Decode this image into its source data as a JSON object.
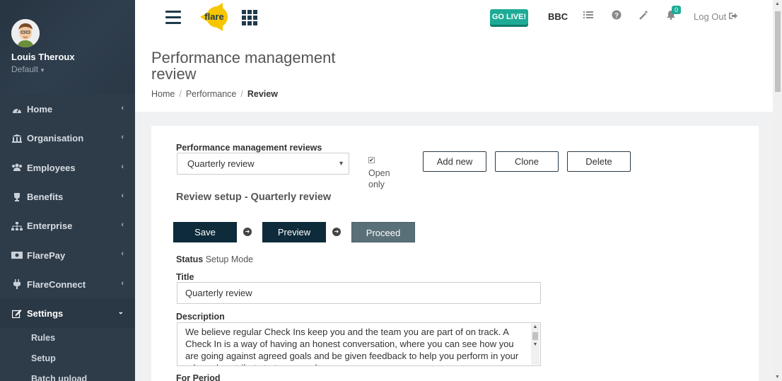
{
  "user": {
    "name": "Louis Theroux",
    "role": "Default"
  },
  "nav": {
    "items": [
      {
        "label": "Home",
        "icon": "dashboard-icon"
      },
      {
        "label": "Organisation",
        "icon": "bank-icon"
      },
      {
        "label": "Employees",
        "icon": "users-icon"
      },
      {
        "label": "Benefits",
        "icon": "trophy-icon"
      },
      {
        "label": "Enterprise",
        "icon": "sitemap-icon"
      },
      {
        "label": "FlarePay",
        "icon": "money-icon"
      },
      {
        "label": "FlareConnect",
        "icon": "plug-icon"
      },
      {
        "label": "Settings",
        "icon": "edit-icon"
      }
    ],
    "settings_sub": [
      "Rules",
      "Setup",
      "Batch upload"
    ]
  },
  "topbar": {
    "logo_text": "flare",
    "golive_label": "GO LIVE!",
    "company": "BBC",
    "notification_count": "0",
    "logout_label": "Log Out"
  },
  "page": {
    "title": "Performance management review",
    "breadcrumb": [
      "Home",
      "Performance",
      "Review"
    ]
  },
  "form": {
    "reviews_label": "Performance management reviews",
    "selected_review": "Quarterly review",
    "open_only_label": "Open only",
    "add_new_label": "Add new",
    "clone_label": "Clone",
    "delete_label": "Delete",
    "setup_heading": "Review setup - Quarterly review",
    "save_label": "Save",
    "preview_label": "Preview",
    "proceed_label": "Proceed",
    "status_label": "Status",
    "status_value": "Setup Mode",
    "title_label": "Title",
    "title_value": "Quarterly review",
    "description_label": "Description",
    "description_value": "We believe regular Check Ins keep you and the team you are part of on track. A Check In is a way of having an honest conversation, where you can see how you are going against agreed goals and be given feedback to help you perform in your role and contribute to team results.",
    "period_label": "For Period"
  },
  "colors": {
    "sidebar": "#2e3c4a",
    "accent": "#1dab96",
    "dark_button": "#0d2b3a",
    "proceed_button": "#5a7078",
    "logo": "#f7c600"
  }
}
